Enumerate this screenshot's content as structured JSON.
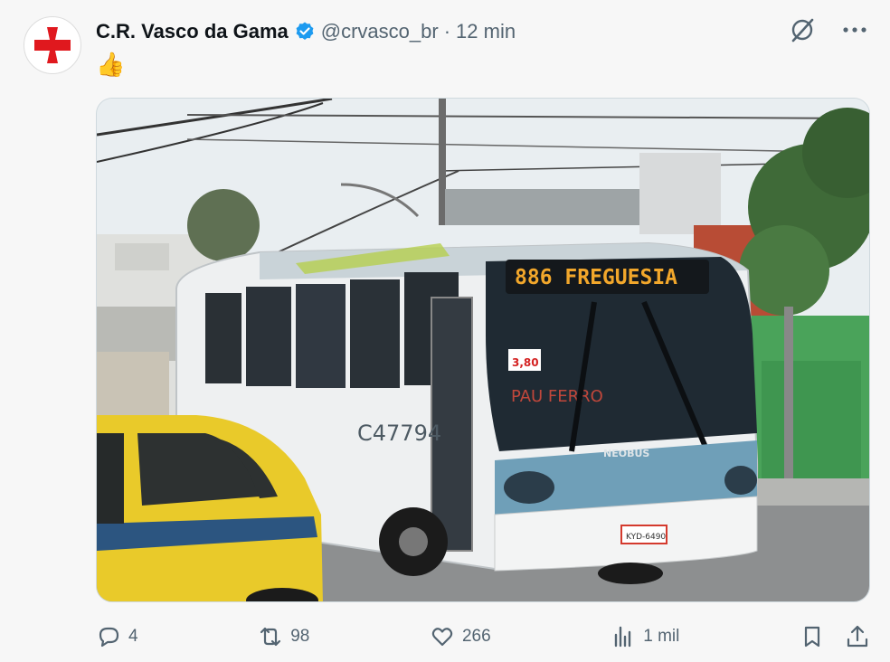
{
  "tweet": {
    "display_name": "C.R. Vasco da Gama",
    "handle": "@crvasco_br",
    "separator": "·",
    "time": "12 min",
    "text": "👍",
    "image": {
      "bus_sign": "886 FREGUESIA",
      "bus_number": "C47794",
      "bus_brand": "NEOBUS",
      "fare_sticker": "3,80",
      "route_text": "PAU FERRO",
      "plate": "KYD-6490"
    }
  },
  "actions": {
    "replies": "4",
    "retweets": "98",
    "likes": "266",
    "views": "1 mil"
  },
  "colors": {
    "verified": "#1d9bf0",
    "muted": "#536471",
    "brand_red": "#e0181e"
  },
  "icons": [
    "vasco-cross-icon",
    "verified-badge-icon",
    "grok-icon",
    "more-icon",
    "reply-icon",
    "retweet-icon",
    "like-icon",
    "views-icon",
    "bookmark-icon",
    "share-icon"
  ]
}
